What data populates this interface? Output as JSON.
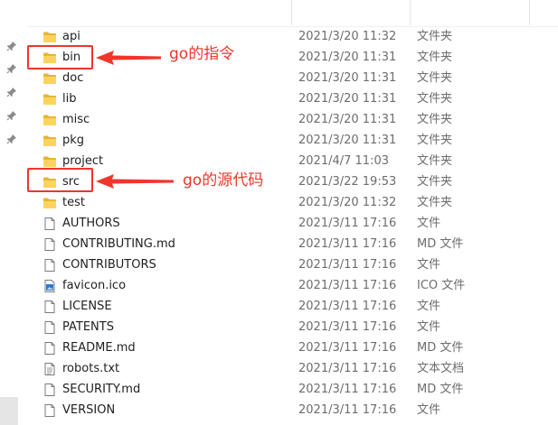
{
  "files": [
    {
      "name": "api",
      "date": "2021/3/20 11:32",
      "type": "文件夹",
      "icon": "folder-icon"
    },
    {
      "name": "bin",
      "date": "2021/3/20 11:31",
      "type": "文件夹",
      "icon": "folder-icon"
    },
    {
      "name": "doc",
      "date": "2021/3/20 11:31",
      "type": "文件夹",
      "icon": "folder-icon"
    },
    {
      "name": "lib",
      "date": "2021/3/20 11:31",
      "type": "文件夹",
      "icon": "folder-icon"
    },
    {
      "name": "misc",
      "date": "2021/3/20 11:31",
      "type": "文件夹",
      "icon": "folder-icon"
    },
    {
      "name": "pkg",
      "date": "2021/3/20 11:31",
      "type": "文件夹",
      "icon": "folder-icon"
    },
    {
      "name": "project",
      "date": "2021/4/7 11:03",
      "type": "文件夹",
      "icon": "folder-icon"
    },
    {
      "name": "src",
      "date": "2021/3/22 19:53",
      "type": "文件夹",
      "icon": "folder-icon"
    },
    {
      "name": "test",
      "date": "2021/3/20 11:32",
      "type": "文件夹",
      "icon": "folder-icon"
    },
    {
      "name": "AUTHORS",
      "date": "2021/3/11 17:16",
      "type": "文件",
      "icon": "document-icon"
    },
    {
      "name": "CONTRIBUTING.md",
      "date": "2021/3/11 17:16",
      "type": "MD 文件",
      "icon": "document-icon"
    },
    {
      "name": "CONTRIBUTORS",
      "date": "2021/3/11 17:16",
      "type": "文件",
      "icon": "document-icon"
    },
    {
      "name": "favicon.ico",
      "date": "2021/3/11 17:16",
      "type": "ICO 文件",
      "icon": "image-icon"
    },
    {
      "name": "LICENSE",
      "date": "2021/3/11 17:16",
      "type": "文件",
      "icon": "document-icon"
    },
    {
      "name": "PATENTS",
      "date": "2021/3/11 17:16",
      "type": "文件",
      "icon": "document-icon"
    },
    {
      "name": "README.md",
      "date": "2021/3/11 17:16",
      "type": "MD 文件",
      "icon": "document-icon"
    },
    {
      "name": "robots.txt",
      "date": "2021/3/11 17:16",
      "type": "文本文档",
      "icon": "text-document-icon"
    },
    {
      "name": "SECURITY.md",
      "date": "2021/3/11 17:16",
      "type": "MD 文件",
      "icon": "document-icon"
    },
    {
      "name": "VERSION",
      "date": "2021/3/11 17:16",
      "type": "文件",
      "icon": "document-icon"
    }
  ],
  "annotations": {
    "bin_note": "go的指令",
    "src_note": "go的源代码",
    "color": "#f0352b"
  },
  "quick_access_pins": [
    "pin-icon",
    "pin-icon",
    "pin-icon",
    "pin-icon",
    "pin-icon"
  ]
}
